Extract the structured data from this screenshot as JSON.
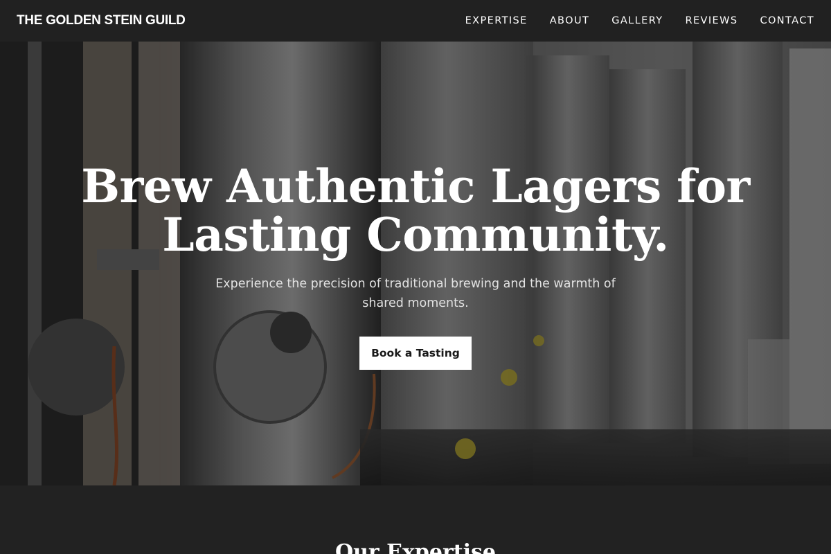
{
  "brand": "THE GOLDEN STEIN GUILD",
  "nav": [
    {
      "label": "EXPERTISE"
    },
    {
      "label": "ABOUT"
    },
    {
      "label": "GALLERY"
    },
    {
      "label": "REVIEWS"
    },
    {
      "label": "CONTACT"
    }
  ],
  "hero": {
    "title": "Brew Authentic Lagers for Lasting Community.",
    "subtitle": "Experience the precision of traditional brewing and the warmth of shared moments.",
    "cta_label": "Book a Tasting"
  },
  "next_section": {
    "title": "Our Expertise"
  },
  "colors": {
    "nav_bg": "#212121",
    "page_bg": "#222222",
    "cta_bg": "#ffffff",
    "cta_text": "#1a1a1a"
  }
}
